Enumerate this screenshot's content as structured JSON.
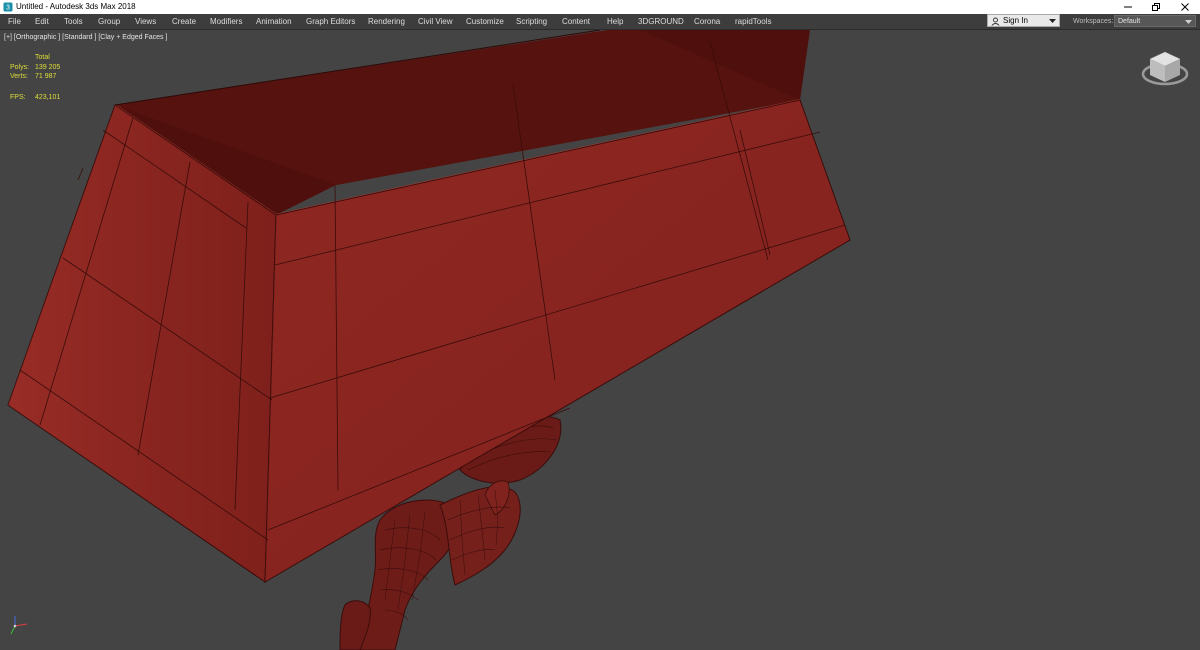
{
  "window": {
    "title": "Untitled - Autodesk 3ds Max 2018",
    "controls": [
      "minimize-icon",
      "restore-icon",
      "close-icon"
    ]
  },
  "menu": {
    "items": [
      "File",
      "Edit",
      "Tools",
      "Group",
      "Views",
      "Create",
      "Modifiers",
      "Animation",
      "Graph Editors",
      "Rendering",
      "Civil View",
      "Customize",
      "Scripting",
      "Content",
      "Help",
      "3DGROUND",
      "Corona",
      "rapidTools"
    ]
  },
  "account": {
    "signin_label": "Sign In",
    "icon": "user-icon"
  },
  "workspaces": {
    "label": "Workspaces:",
    "value": "Default"
  },
  "viewport": {
    "label": "[+] [Orthographic ] [Standard ] [Clay + Edged Faces ]",
    "stats": {
      "header": "Total",
      "polys_label": "Polys:",
      "polys_value": "139 205",
      "verts_label": "Verts:",
      "verts_value": "71 987",
      "fps_label": "FPS:",
      "fps_value": "423,101"
    }
  },
  "colors": {
    "viewport_bg": "#444444",
    "model_clay": "#8c2520",
    "menu_bg": "#3d3d3d",
    "stats_text": "#dede3a"
  }
}
